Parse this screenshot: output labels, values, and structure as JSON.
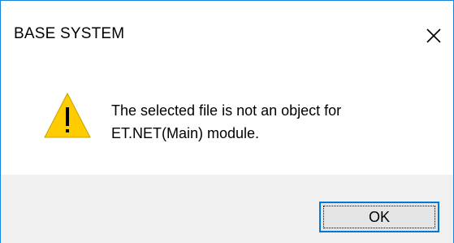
{
  "dialog": {
    "title": "BASE SYSTEM",
    "close_icon": "close-icon",
    "warning_icon": "warning-triangle-icon",
    "message": "The selected file is not an object for\nET.NET(Main) module.",
    "ok_label": "OK",
    "colors": {
      "window_border": "#1883d7",
      "footer_background": "#f0f0f0",
      "button_border": "#0078d7",
      "warning_fill": "#ffcc00"
    }
  }
}
